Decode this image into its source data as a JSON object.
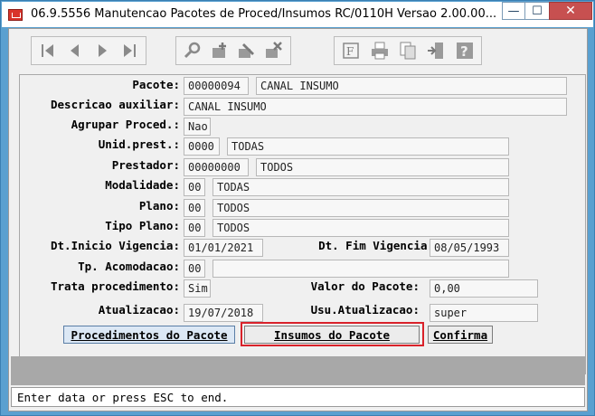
{
  "window": {
    "title": "06.9.5556 Manutencao  Pacotes de Proced/Insumos RC/0110H Versao 2.00.00...",
    "min_glyph": "—",
    "max_glyph": "☐",
    "close_glyph": "✕"
  },
  "toolbar": {
    "nav_icons": [
      "first-record-icon",
      "previous-record-icon",
      "next-record-icon",
      "last-record-icon"
    ],
    "edit_icons": [
      "search-key-icon",
      "add-record-icon",
      "edit-pencil-icon",
      "delete-record-icon"
    ],
    "other_icons": [
      "filter-icon",
      "print-icon",
      "copy-pages-icon",
      "exit-door-icon",
      "help-icon"
    ]
  },
  "form": {
    "pacote": {
      "label": "Pacote:",
      "code": "00000094",
      "desc": "CANAL INSUMO"
    },
    "descricao": {
      "label": "Descricao auxiliar:",
      "value": "CANAL INSUMO"
    },
    "agrupar": {
      "label": "Agrupar Proced.:",
      "value": "Nao"
    },
    "unid_prest": {
      "label": "Unid.prest.:",
      "code": "0000",
      "desc": "TODAS"
    },
    "prestador": {
      "label": "Prestador:",
      "code": "00000000",
      "desc": "TODOS"
    },
    "modalidade": {
      "label": "Modalidade:",
      "code": "00",
      "desc": "TODAS"
    },
    "plano": {
      "label": "Plano:",
      "code": "00",
      "desc": "TODOS"
    },
    "tipo_plano": {
      "label": "Tipo Plano:",
      "code": "00",
      "desc": "TODOS"
    },
    "dt_inicio": {
      "label": "Dt.Inicio Vigencia:",
      "value": "01/01/2021"
    },
    "dt_fim": {
      "label": "Dt. Fim Vigencia:",
      "value": "08/05/1993"
    },
    "tp_acomodacao": {
      "label": "Tp. Acomodacao:",
      "code": "00",
      "desc": ""
    },
    "trata_proc": {
      "label": "Trata procedimento:",
      "value": "Sim"
    },
    "valor_pacote": {
      "label": "Valor do Pacote:",
      "value": "0,00"
    },
    "atualizacao": {
      "label": "Atualizacao:",
      "value": "19/07/2018"
    },
    "usu_atualizacao": {
      "label": "Usu.Atualizacao:",
      "value": "super"
    }
  },
  "buttons": {
    "procedimentos": "Procedimentos do Pacote",
    "insumos": "Insumos do Pacote",
    "confirma": "Confirma"
  },
  "status": {
    "message": "Enter data or press ESC to end."
  },
  "colors": {
    "highlight": "#d9222a",
    "title_close": "#c75050"
  }
}
